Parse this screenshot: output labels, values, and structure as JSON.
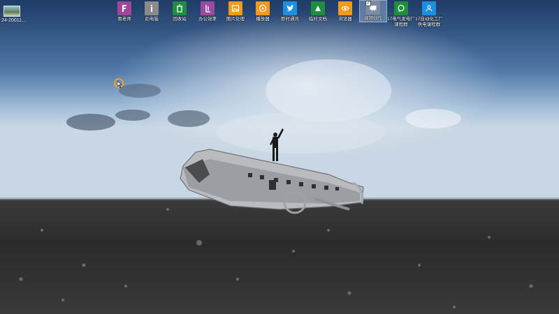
{
  "desktop": {
    "file": {
      "label": "24-20011..."
    },
    "icons": [
      {
        "label": "雨老师",
        "color": "#a0479b",
        "icon": "form-icon"
      },
      {
        "label": "此电脑",
        "color": "#8a8a8a",
        "icon": "info-icon"
      },
      {
        "label": "回收站",
        "color": "#1e8f3c",
        "icon": "recycle-icon"
      },
      {
        "label": "办公效率",
        "color": "#9b4aa0",
        "icon": "office-icon"
      },
      {
        "label": "图片处理",
        "color": "#f29a1c",
        "icon": "image-icon"
      },
      {
        "label": "播放器",
        "color": "#f29a1c",
        "icon": "player-icon"
      },
      {
        "label": "即时通讯",
        "color": "#1d8fe0",
        "icon": "twitter-icon"
      },
      {
        "label": "临时文档",
        "color": "#1e8f3c",
        "icon": "triangle-icon"
      },
      {
        "label": "浏览器",
        "color": "#f29a1c",
        "icon": "eye-icon"
      },
      {
        "label": "视频创作",
        "color": "#7d8aa0",
        "icon": "video-icon",
        "selected": true
      },
      {
        "label": "17电气发电厂课程群",
        "color": "#1e8f3c",
        "icon": "chat-icon"
      },
      {
        "label": "17自动化工厂供电课程群",
        "color": "#1d8fe0",
        "icon": "group-icon"
      }
    ]
  },
  "colors": {
    "sky_top": "#2a4a78",
    "sky_mid": "#8fb0cf",
    "ground": "#2a2a2a"
  }
}
